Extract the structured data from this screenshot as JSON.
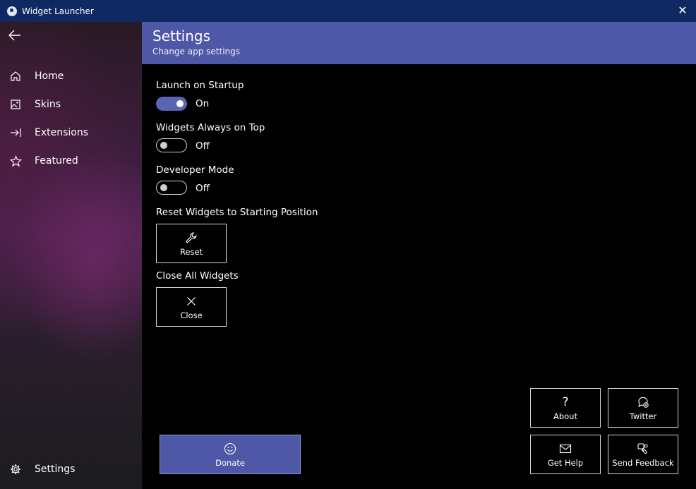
{
  "window": {
    "title": "Widget Launcher"
  },
  "sidebar": {
    "items": [
      {
        "label": "Home",
        "icon": "home-icon"
      },
      {
        "label": "Skins",
        "icon": "image-icon"
      },
      {
        "label": "Extensions",
        "icon": "arrow-to-bar-icon"
      },
      {
        "label": "Featured",
        "icon": "star-icon"
      }
    ],
    "footer": {
      "label": "Settings",
      "icon": "gear-icon"
    }
  },
  "header": {
    "title": "Settings",
    "subtitle": "Change app settings"
  },
  "settings": {
    "launch_startup": {
      "label": "Launch on Startup",
      "state": "On"
    },
    "always_on_top": {
      "label": "Widgets Always on Top",
      "state": "Off"
    },
    "developer_mode": {
      "label": "Developer Mode",
      "state": "Off"
    },
    "reset_widgets": {
      "label": "Reset Widgets to Starting Position",
      "button": "Reset"
    },
    "close_widgets": {
      "label": "Close All Widgets",
      "button": "Close"
    }
  },
  "actions": {
    "donate": "Donate",
    "about": "About",
    "twitter": "Twitter",
    "get_help": "Get Help",
    "send_feedback": "Send Feedback"
  },
  "colors": {
    "titlebar": "#0f2a63",
    "accent": "#4e58a6",
    "toggle_on": "#5a64b3"
  }
}
